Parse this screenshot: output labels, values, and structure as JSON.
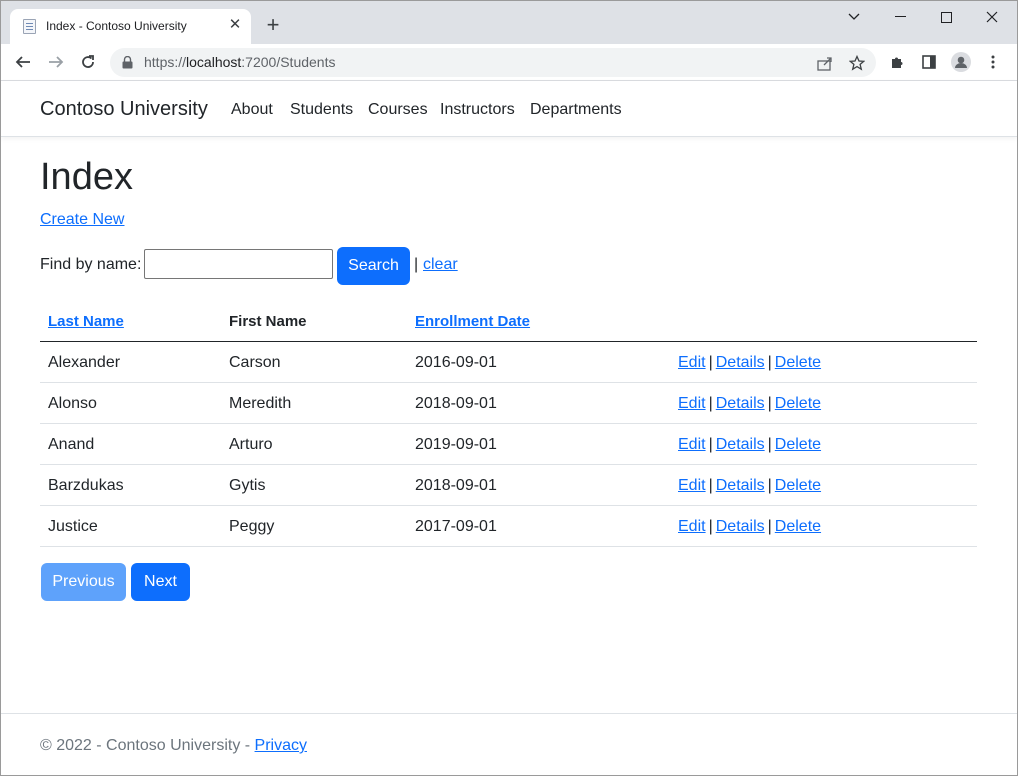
{
  "browser": {
    "tab_title": "Index - Contoso University",
    "tab_close": "✕",
    "new_tab": "+",
    "url_scheme": "https://",
    "url_host": "localhost",
    "url_path": ":7200/Students"
  },
  "site": {
    "brand": "Contoso University",
    "nav": [
      "About",
      "Students",
      "Courses",
      "Instructors",
      "Departments"
    ]
  },
  "page": {
    "title": "Index",
    "create_new": "Create New",
    "find_label": "Find by name:",
    "search_value": "",
    "search_button": "Search",
    "separator": "|",
    "clear": "clear"
  },
  "table": {
    "headers": {
      "last_name": "Last Name",
      "first_name": "First Name",
      "enrollment_date": "Enrollment Date"
    },
    "rows": [
      {
        "last": "Alexander",
        "first": "Carson",
        "date": "2016-09-01"
      },
      {
        "last": "Alonso",
        "first": "Meredith",
        "date": "2018-09-01"
      },
      {
        "last": "Anand",
        "first": "Arturo",
        "date": "2019-09-01"
      },
      {
        "last": "Barzdukas",
        "first": "Gytis",
        "date": "2018-09-01"
      },
      {
        "last": "Justice",
        "first": "Peggy",
        "date": "2017-09-01"
      }
    ],
    "actions": {
      "edit": "Edit",
      "details": "Details",
      "delete": "Delete",
      "separator": "|"
    }
  },
  "pager": {
    "previous": "Previous",
    "next": "Next"
  },
  "footer": {
    "text": "© 2022 - Contoso University - ",
    "privacy": "Privacy"
  },
  "colors": {
    "primary": "#0d6efd",
    "primary_disabled": "#5ea2fb",
    "text": "#212529",
    "muted": "#6c757d"
  }
}
